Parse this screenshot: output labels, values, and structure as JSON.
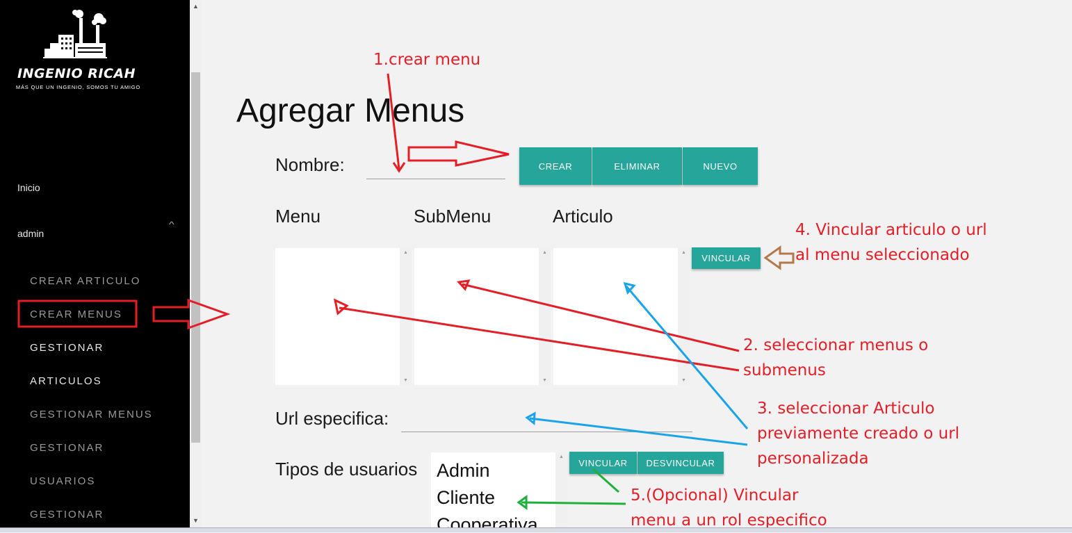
{
  "sidebar": {
    "brand_title": "INGENIO RICAH",
    "brand_subtitle": "MÁS QUE UN INGENIO, SOMOS TU AMIGO",
    "home_label": "Inicio",
    "user_label": "admin",
    "items": [
      {
        "label": "CREAR ARTICULO"
      },
      {
        "label": "CREAR MENUS"
      },
      {
        "label": "GESTIONAR"
      },
      {
        "label": "ARTICULOS"
      },
      {
        "label": "GESTIONAR MENUS"
      },
      {
        "label": "GESTIONAR"
      },
      {
        "label": "USUARIOS"
      },
      {
        "label": "GESTIONAR"
      }
    ]
  },
  "main": {
    "title": "Agregar Menus",
    "name_label": "Nombre:",
    "name_value": "",
    "buttons": {
      "create": "CREAR",
      "delete": "ELIMINAR",
      "new": "NUEVO",
      "link": "VINCULAR",
      "link_role": "VINCULAR",
      "unlink_role": "DESVINCULAR"
    },
    "columns": {
      "menu": "Menu",
      "submenu": "SubMenu",
      "article": "Articulo"
    },
    "url_label": "Url especifica:",
    "url_value": "",
    "user_types_label": "Tipos de usuarios",
    "user_types": [
      "Admin",
      "Cliente",
      "Cooperativa"
    ]
  },
  "annotations": {
    "step1": "1.crear menu",
    "step2_line1": "2. seleccionar menus o",
    "step2_line2": "submenus",
    "step3_line1": "3. seleccionar Articulo",
    "step3_line2": "previamente creado o url",
    "step3_line3": "personalizada",
    "step4_line1": "4. Vincular articulo o url",
    "step4_line2": "al menu seleccionado",
    "step5_line1": "5.(Opcional) Vincular",
    "step5_line2": "menu a un rol especifico"
  },
  "colors": {
    "accent": "#26a69a",
    "annotation_red": "#e41e26",
    "annotation_blue": "#1aa3e8",
    "annotation_green": "#1fb03c",
    "annotation_brown": "#b5784a",
    "sidebar_bg": "#000000"
  }
}
